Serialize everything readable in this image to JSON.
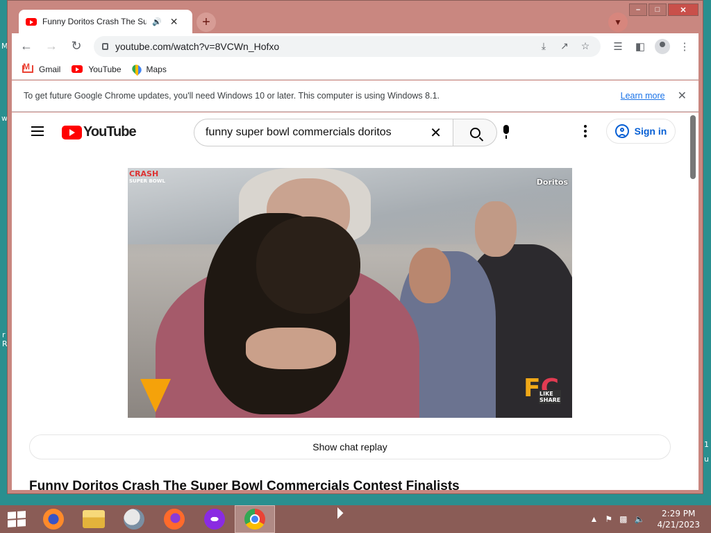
{
  "desktop": {
    "fragments": [
      "M",
      "w",
      "r",
      "R",
      "1",
      "u"
    ]
  },
  "browser": {
    "tab": {
      "title": "Funny Doritos Crash The Sup",
      "audio_icon": "speaker-icon",
      "close_icon": "close-icon"
    },
    "new_tab_label": "+",
    "address": {
      "url": "youtube.com/watch?v=8VCWn_Hofxo"
    },
    "bookmarks": [
      {
        "label": "Gmail",
        "icon": "gmail-icon"
      },
      {
        "label": "YouTube",
        "icon": "youtube-icon"
      },
      {
        "label": "Maps",
        "icon": "maps-icon"
      }
    ],
    "infobar": {
      "text": "To get future Google Chrome updates, you'll need Windows 10 or later. This computer is using Windows 8.1.",
      "link": "Learn more"
    }
  },
  "youtube": {
    "logo_text": "YouTube",
    "search": {
      "value": "funny super bowl commercials doritos"
    },
    "sign_in": "Sign in",
    "video": {
      "overlay_top_left": "CRASH",
      "overlay_top_left_sub": "SUPER BOWL",
      "overlay_top_right": "Doritos",
      "badge_letters_1": "F",
      "badge_letters_2": "C",
      "badge_like": "LIKE",
      "badge_share": "SHARE"
    },
    "chat_replay": "Show chat replay",
    "title": "Funny Doritos Crash The Super Bowl Commercials Contest Finalists"
  },
  "taskbar": {
    "apps": [
      {
        "name": "firefox-icon"
      },
      {
        "name": "file-explorer-icon"
      },
      {
        "name": "thunderbird-icon"
      },
      {
        "name": "firefox-dev-icon"
      },
      {
        "name": "mask-app-icon"
      },
      {
        "name": "chrome-icon",
        "active": true
      }
    ],
    "clock": {
      "time": "2:29 PM",
      "date": "4/21/2023"
    }
  },
  "colors": {
    "window_frame": "#c98780",
    "taskbar": "#8a5c56",
    "desktop": "#2a8f8f",
    "youtube_red": "#ff0000",
    "link_blue": "#1a73e8",
    "signin_blue": "#065fd4"
  }
}
